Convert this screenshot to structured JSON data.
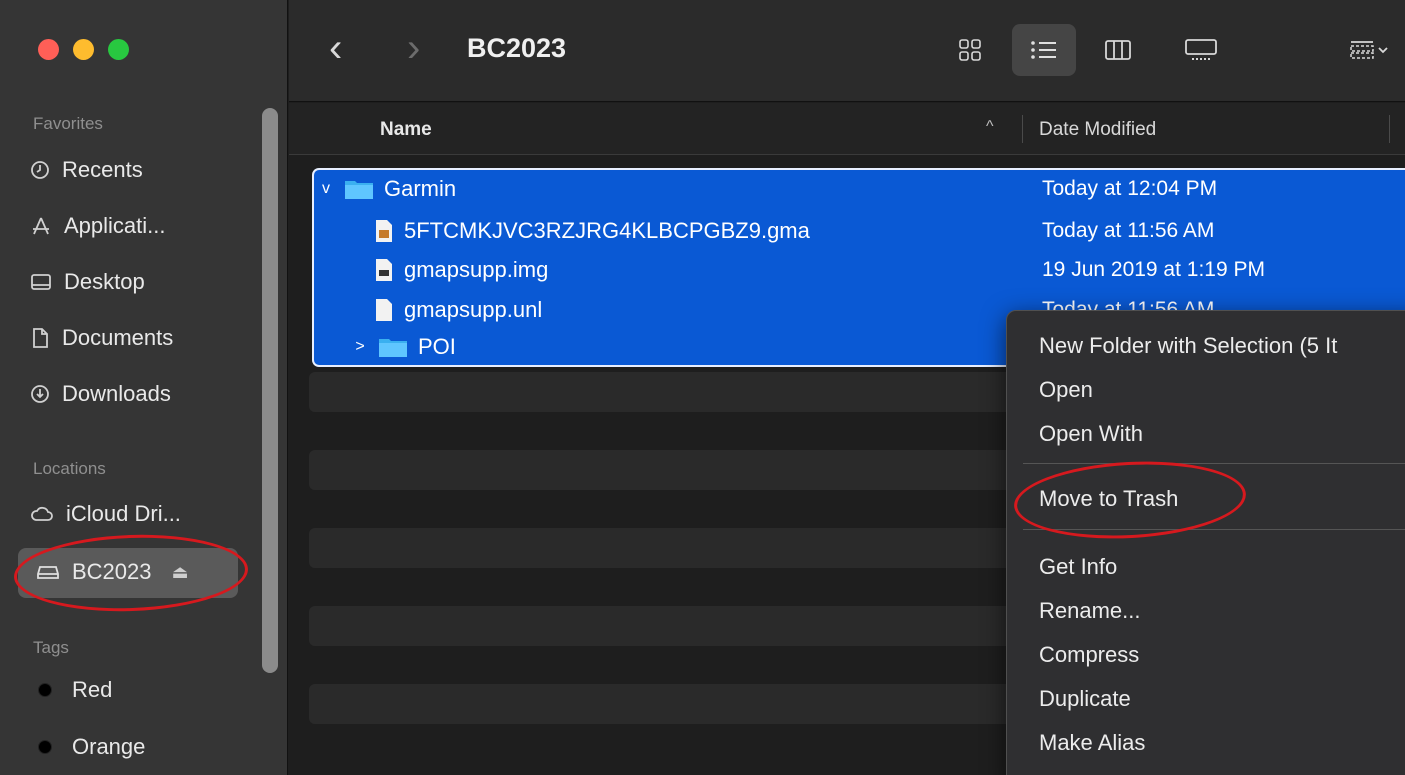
{
  "window": {
    "title": "BC2023"
  },
  "traffic_lights": {
    "close": "#ff5f57",
    "minimize": "#febc2e",
    "zoom": "#28c840"
  },
  "toolbar": {
    "back_icon": "chevron-left-icon",
    "forward_icon": "chevron-right-icon",
    "views": [
      "icon-view",
      "list-view",
      "column-view",
      "gallery-view",
      "group-view"
    ],
    "active_view": "list-view"
  },
  "sidebar": {
    "favorites_label": "Favorites",
    "favorites": [
      {
        "label": "Recents",
        "icon": "clock-icon"
      },
      {
        "label": "Applicati...",
        "icon": "applications-icon"
      },
      {
        "label": "Desktop",
        "icon": "desktop-icon"
      },
      {
        "label": "Documents",
        "icon": "document-icon"
      },
      {
        "label": "Downloads",
        "icon": "download-icon"
      }
    ],
    "locations_label": "Locations",
    "locations": [
      {
        "label": "iCloud Dri...",
        "icon": "cloud-icon"
      },
      {
        "label": "BC2023",
        "icon": "drive-icon",
        "eject": "⏏"
      }
    ],
    "tags_label": "Tags",
    "tags": [
      {
        "label": "Red"
      },
      {
        "label": "Orange"
      }
    ]
  },
  "columns": {
    "name": "Name",
    "date": "Date Modified",
    "sort_arrow": "^"
  },
  "files": [
    {
      "name": "Garmin",
      "date": "Today at 12:04 PM",
      "kind": "folder",
      "disclosure": "v"
    },
    {
      "name": "5FTCMKJVC3RZJRG4KLBCPGBZ9.gma",
      "date": "Today at 11:56 AM",
      "kind": "file"
    },
    {
      "name": "gmapsupp.img",
      "date": "19 Jun 2019 at 1:19 PM",
      "kind": "file"
    },
    {
      "name": "gmapsupp.unl",
      "date": "Today at 11:56 AM",
      "kind": "file"
    },
    {
      "name": "POI",
      "date": "",
      "kind": "folder",
      "disclosure": ">"
    }
  ],
  "context_menu": {
    "items": [
      "New Folder with Selection (5 It",
      "Open",
      "Open With",
      "Move to Trash",
      "Get Info",
      "Rename...",
      "Compress",
      "Duplicate",
      "Make Alias"
    ]
  },
  "colors": {
    "selection": "#0a59d4",
    "annotation": "#d6191e"
  }
}
